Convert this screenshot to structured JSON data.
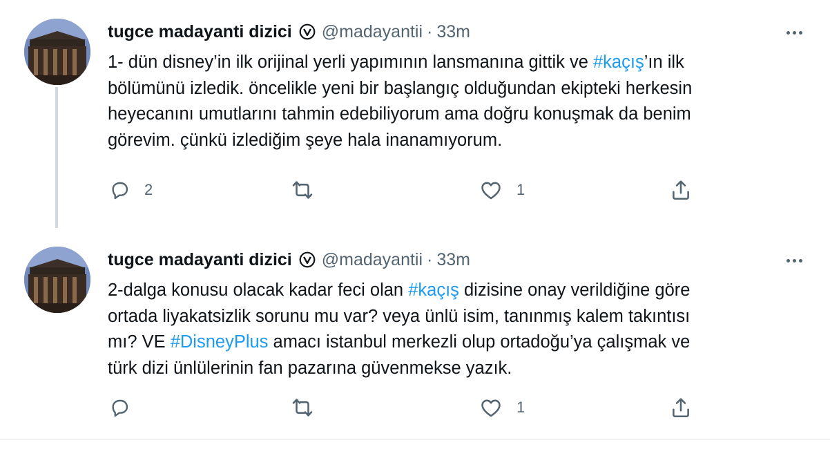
{
  "tweets": [
    {
      "author": {
        "display_name": "tugce madayanti dizici",
        "handle": "@madayantii",
        "verified_icon": "verified-badge-icon"
      },
      "separator": "·",
      "timestamp": "33m",
      "text_lines": [
        [
          {
            "t": "1- dün disney’in ilk orijinal yerli yapımının lansmanına gittik ve "
          },
          {
            "t": "#kaçış",
            "tag": true
          },
          {
            "t": "’ın ilk"
          }
        ],
        [
          {
            "t": "bölümünü izledik. öncelikle yeni bir başlangıç olduğundan ekipteki herkesin"
          }
        ],
        [
          {
            "t": "heyecanını umutlarını tahmin edebiliyorum ama doğru konuşmak da benim"
          }
        ],
        [
          {
            "t": "görevim. çünkü izlediğim şeye hala inanamıyorum."
          }
        ]
      ],
      "actions": {
        "reply_count": "2",
        "retweet_count": "",
        "like_count": "1"
      }
    },
    {
      "author": {
        "display_name": "tugce madayanti dizici",
        "handle": "@madayantii",
        "verified_icon": "verified-badge-icon"
      },
      "separator": "·",
      "timestamp": "33m",
      "text_lines": [
        [
          {
            "t": "2-dalga konusu olacak kadar feci olan "
          },
          {
            "t": "#kaçış",
            "tag": true
          },
          {
            "t": " dizisine onay verildiğine göre"
          }
        ],
        [
          {
            "t": "ortada liyakatsizlik sorunu mu var? veya ünlü isim, tanınmış kalem takıntısı"
          }
        ],
        [
          {
            "t": "mı? VE "
          },
          {
            "t": "#DisneyPlus",
            "tag": true
          },
          {
            "t": " amacı istanbul merkezli olup ortadoğu’ya çalışmak ve"
          }
        ],
        [
          {
            "t": "türk dizi ünlülerinin fan pazarına güvenmekse yazık."
          }
        ]
      ],
      "actions": {
        "reply_count": "",
        "retweet_count": "",
        "like_count": "1"
      }
    }
  ],
  "icons": [
    "reply-icon",
    "retweet-icon",
    "like-icon",
    "share-icon",
    "more-icon",
    "verified-badge-icon"
  ],
  "colors": {
    "text": "#0f1419",
    "secondary": "#536471",
    "hashtag": "#1d9bf0",
    "thread_line": "#cfd9de"
  }
}
